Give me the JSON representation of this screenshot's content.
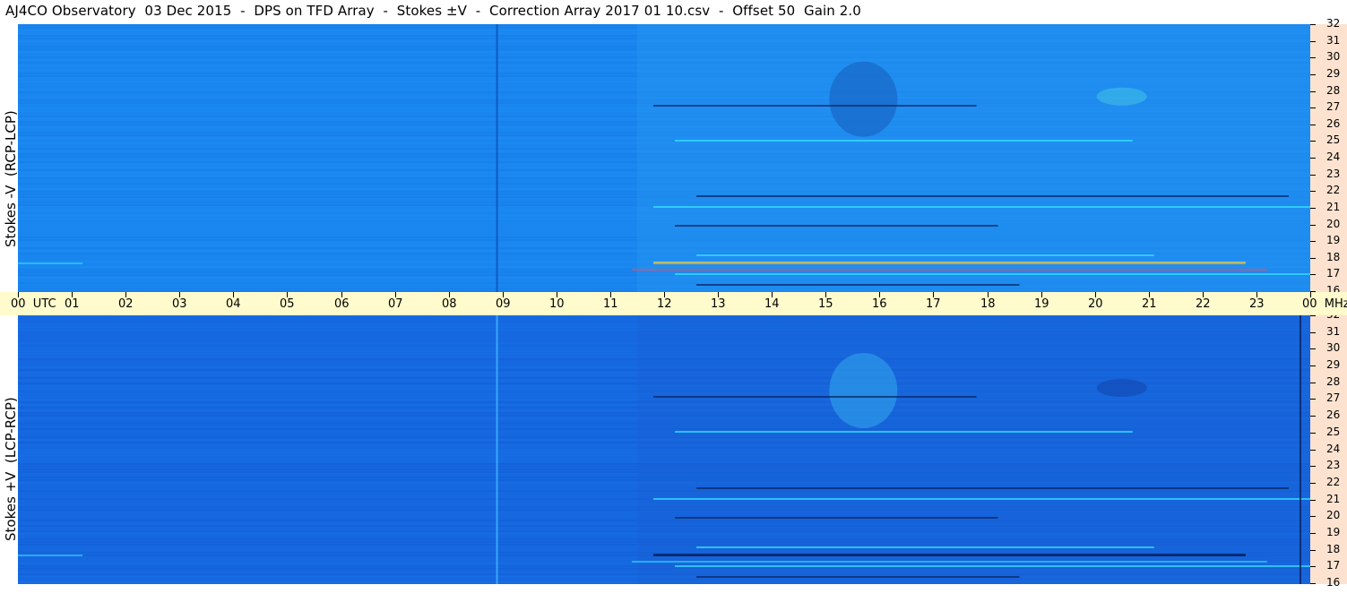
{
  "header": {
    "title": "AJ4CO Observatory  03 Dec 2015  -  DPS on TFD Array  -  Stokes ±V  -  Correction Array 2017 01 10.csv  -  Offset 50  Gain 2.0"
  },
  "panels": {
    "top_label": "Stokes -V  (RCP-LCP)",
    "bottom_label": "Stokes +V  (LCP-RCP)"
  },
  "time_axis": {
    "labels": [
      "00  UTC",
      "01",
      "02",
      "03",
      "04",
      "05",
      "06",
      "07",
      "08",
      "09",
      "10",
      "11",
      "12",
      "13",
      "14",
      "15",
      "16",
      "17",
      "18",
      "19",
      "20",
      "21",
      "22",
      "23",
      "00  MHz"
    ]
  },
  "freq_axis": {
    "labels": [
      "32",
      "31",
      "30",
      "29",
      "28",
      "27",
      "26",
      "25",
      "24",
      "23",
      "22",
      "21",
      "20",
      "19",
      "18",
      "17",
      "16"
    ]
  },
  "colors": {
    "top_background": "#1a86f0",
    "bottom_background": "#1668e0",
    "time_band": "#fffbcc",
    "freq_band": "#fde3cf"
  },
  "chart_data": {
    "type": "heatmap",
    "title": "AJ4CO Observatory  03 Dec 2015  -  DPS on TFD Array  -  Stokes ±V  -  Correction Array 2017 01 10.csv  -  Offset 50  Gain 2.0",
    "x_axis": {
      "label": "UTC",
      "range": [
        0,
        24
      ],
      "ticks": [
        "00",
        "01",
        "02",
        "03",
        "04",
        "05",
        "06",
        "07",
        "08",
        "09",
        "10",
        "11",
        "12",
        "13",
        "14",
        "15",
        "16",
        "17",
        "18",
        "19",
        "20",
        "21",
        "22",
        "23",
        "00"
      ]
    },
    "y_axis": {
      "label": "MHz",
      "range": [
        16,
        32
      ],
      "ticks": [
        32,
        31,
        30,
        29,
        28,
        27,
        26,
        25,
        24,
        23,
        22,
        21,
        20,
        19,
        18,
        17,
        16
      ]
    },
    "panels": [
      "Stokes -V  (RCP-LCP)",
      "Stokes +V  (LCP-RCP)"
    ],
    "grid": false
  }
}
